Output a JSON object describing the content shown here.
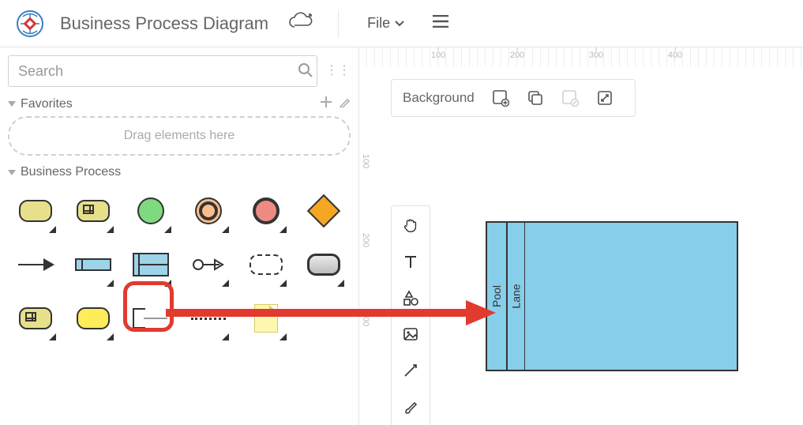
{
  "header": {
    "title": "Business Process Diagram",
    "file_menu_label": "File"
  },
  "sidebar": {
    "search_placeholder": "Search",
    "favorites_label": "Favorites",
    "drop_hint": "Drag elements here",
    "business_process_label": "Business Process"
  },
  "canvas": {
    "background_label": "Background",
    "ruler_h": [
      "100",
      "200",
      "300",
      "400"
    ],
    "ruler_v": [
      "100",
      "200",
      "300"
    ]
  },
  "pool": {
    "pool_label": "Pool",
    "lane_label": "Lane"
  },
  "shapes": {
    "task_yellow": {
      "fill": "#e6e08b"
    },
    "task_green_outline": {
      "fill": "#e6e08b"
    },
    "start_green": {
      "fill": "#7fd97f"
    },
    "ring_orange": {
      "fill": "#fbbd8b"
    },
    "end_red": {
      "fill": "#ed8a84"
    },
    "gateway_orange": {
      "fill": "#f5a623"
    },
    "pool_mini": {
      "fill": "#9dd4ea"
    },
    "rounded_gray": {
      "fill": "#c8c8c8"
    },
    "subprocess_yellow": {
      "fill": "#e6e08b"
    },
    "task_yellow_bright": {
      "fill": "#ffec59"
    },
    "note_yellow": {
      "fill": "#fff7b0"
    }
  }
}
